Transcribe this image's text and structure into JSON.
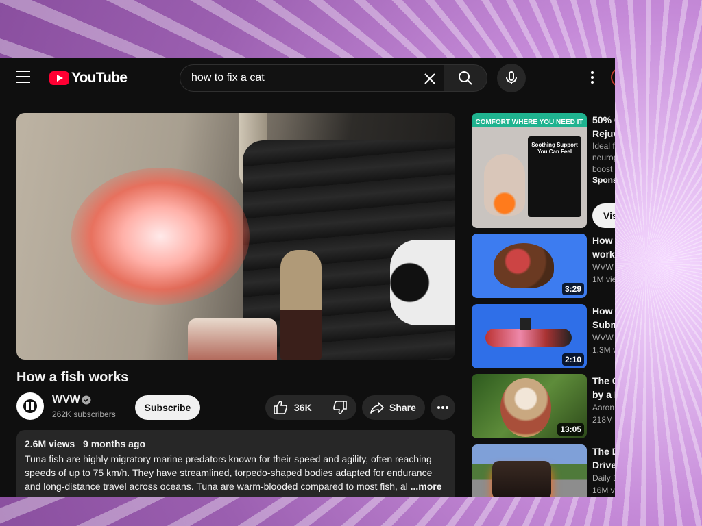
{
  "header": {
    "logo_text": "YouTube",
    "search": {
      "value": "how to fix a cat"
    }
  },
  "video": {
    "title": "How a fish works",
    "channel": {
      "name": "WVW",
      "subscribers": "262K subscribers"
    },
    "subscribe_label": "Subscribe",
    "likes": "36K",
    "share_label": "Share",
    "description": {
      "views": "2.6M views",
      "age": "9 months ago",
      "text": "Tuna fish are highly migratory marine predators known for their speed and agility, often reaching speeds of up to 75 km/h. They have streamlined, torpedo-shaped bodies adapted for endurance and long-distance travel across oceans. Tuna are warm-blooded compared to most fish, al",
      "more_label": "...more"
    }
  },
  "ad": {
    "banner": "COMFORT WHERE YOU NEED IT",
    "box_text": "Soothing Support You Can Feel",
    "title_lines": [
      "50% C",
      "Rejuv"
    ],
    "desc_lines": [
      "Ideal f",
      "neurop",
      "boost"
    ],
    "sponsored": "Spons",
    "visit_label": "Vis"
  },
  "recommendations": [
    {
      "title_lines": [
        "How",
        "works"
      ],
      "channel": "WVW",
      "views": "1M vie",
      "duration": "3:29",
      "thumb_color": "#3d7cf0"
    },
    {
      "title_lines": [
        "How",
        "Subm"
      ],
      "channel": "WVW",
      "views": "1.3M v",
      "duration": "2:10",
      "thumb_color": "#2f6fe8"
    },
    {
      "title_lines": [
        "The C",
        "by a F"
      ],
      "channel": "Aaron",
      "views": "218M",
      "duration": "13:05",
      "thumb_color": "#3e6b2a"
    },
    {
      "title_lines": [
        "The D",
        "Drive"
      ],
      "channel": "Daily D",
      "views": "16M v",
      "duration": "",
      "thumb_color": "#8aa07a"
    }
  ],
  "colors": {
    "background": "#0f0f0f",
    "brand_red": "#ff0033",
    "surface": "#272727"
  }
}
